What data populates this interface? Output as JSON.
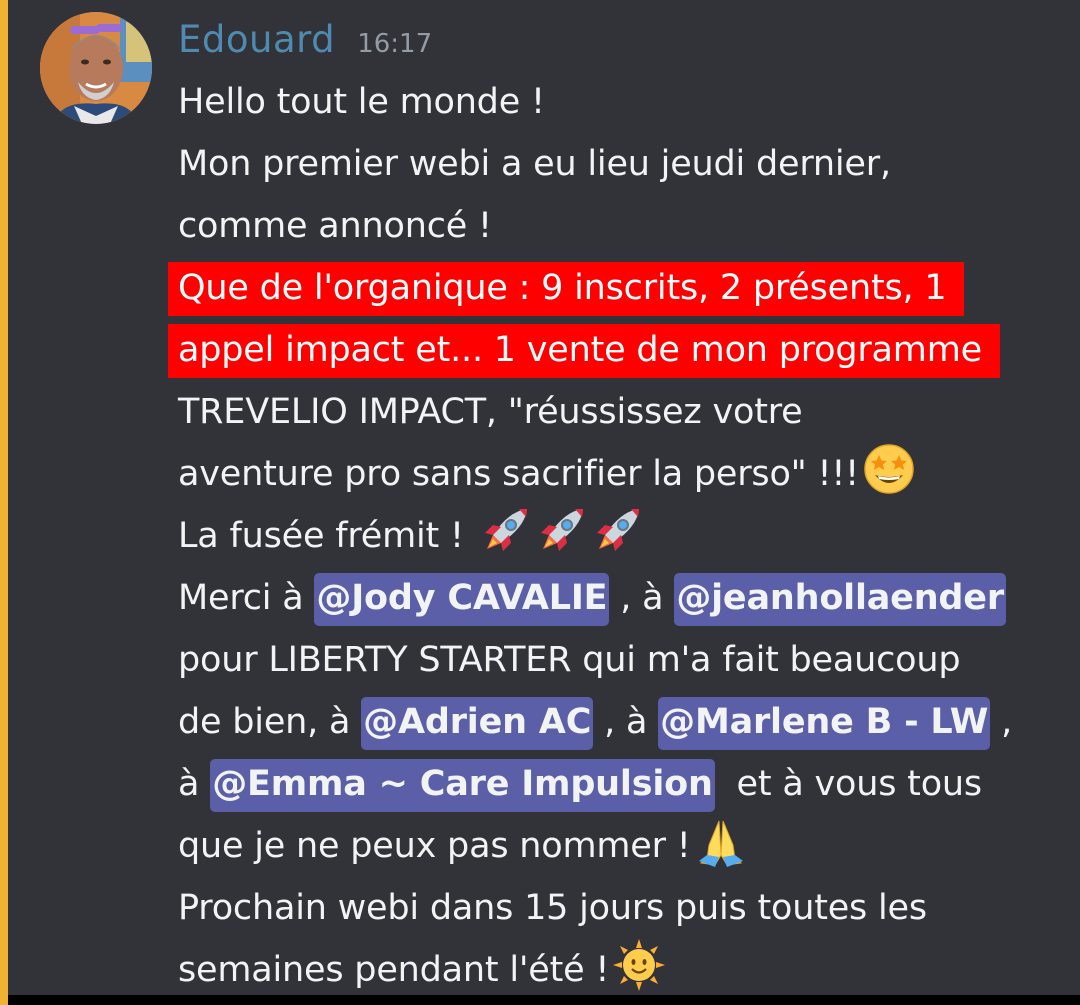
{
  "message": {
    "author": "Edouard",
    "timestamp": "16:17",
    "avatar_icon": "user-avatar-photo",
    "colors": {
      "author": "#4f8ab0",
      "background": "#313338",
      "highlight": "#ff0000",
      "mention": "#5b5fa7",
      "side_bar": "#f0b232"
    },
    "lines": {
      "l1": "Hello tout le monde !",
      "l2": "Mon premier webi a eu lieu jeudi dernier,",
      "l3": "comme annoncé !",
      "l4": "Que de l'organique : 9 inscrits, 2 présents, 1",
      "l5": "appel impact et... 1 vente de mon programme",
      "l6": "TREVELIO IMPACT, \"réussissez votre",
      "l7": "aventure pro sans sacrifier la perso\" !!!",
      "l8": "La fusée frémit !",
      "l9_a": "Merci à ",
      "l9_b": " , à ",
      "l10": "pour LIBERTY STARTER qui m'a fait beaucoup",
      "l11_a": "de bien, à ",
      "l11_b": " , à ",
      "l11_c": " ,",
      "l12_a": "à ",
      "l12_b": "  et à vous tous",
      "l13": "que je ne peux pas nommer !",
      "l14": "Prochain webi dans 15 jours puis toutes les",
      "l15": "semaines pendant l'été !"
    },
    "mentions": {
      "jody": "@Jody CAVALIE",
      "jean": "@jeanhollaender",
      "adrien": "@Adrien AC",
      "marlene": "@Marlene B - LW",
      "emma": "@Emma ~ Care Impulsion"
    },
    "emojis": {
      "star_struck": "star-struck-emoji",
      "rocket": "rocket-emoji",
      "praying": "folded-hands-emoji",
      "sun": "sun-with-face-emoji"
    }
  }
}
